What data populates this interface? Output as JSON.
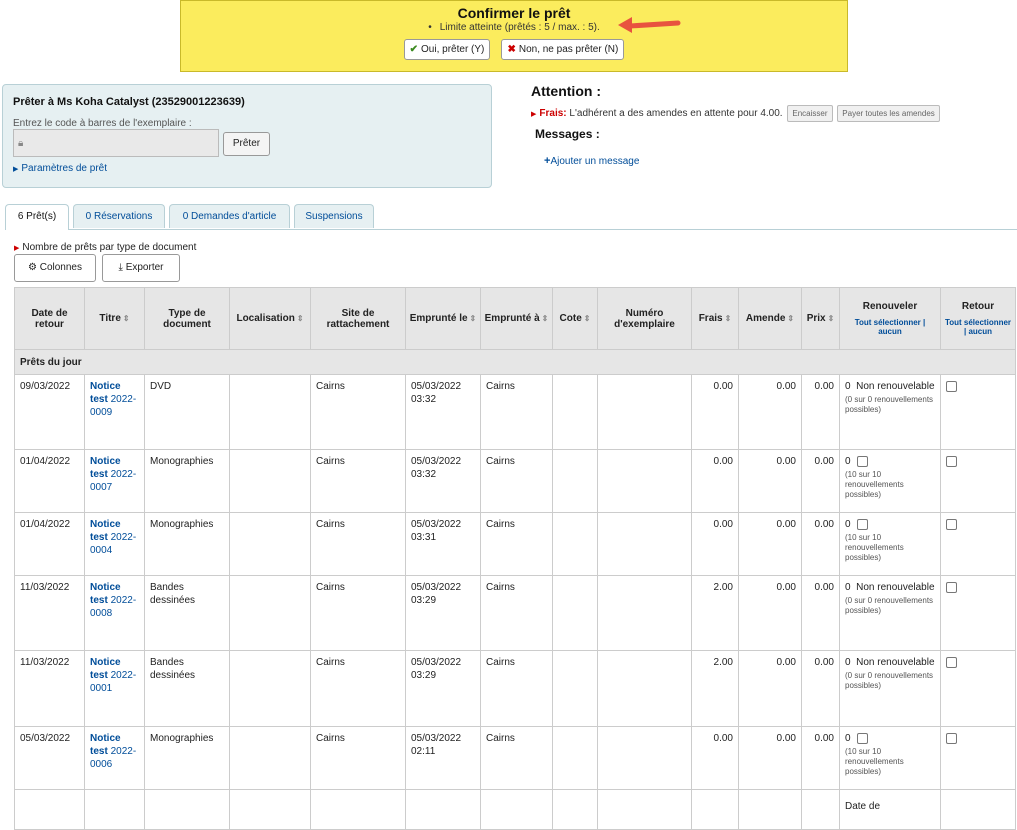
{
  "confirm": {
    "title": "Confirmer le prêt",
    "limit_text": "Limite atteinte (prêtés : 5 / max. : 5).",
    "yes_label": "Oui, prêter (Y)",
    "no_label": "Non, ne pas prêter (N)"
  },
  "checkout": {
    "title": "Prêter à Ms Koha Catalyst (23529001223639)",
    "barcode_label": "Entrez le code à barres de l'exemplaire :",
    "button": "Prêter",
    "settings_link": "Paramètres de prêt"
  },
  "attention": {
    "title": "Attention :",
    "fines_label": "Frais:",
    "fines_text": "L'adhérent a des amendes en attente pour 4.00.",
    "pay_button": "Encaisser",
    "pay_all_button": "Payer toutes les amendes",
    "messages_title": "Messages :",
    "add_message": "Ajouter un message"
  },
  "tabs": [
    "6 Prêt(s)",
    "0 Réservations",
    "0 Demandes d'article",
    "Suspensions"
  ],
  "count_by_type": "Nombre de prêts par type de document",
  "toolbar": {
    "columns": "Colonnes",
    "export": "Exporter"
  },
  "table": {
    "headers": {
      "due": "Date de retour",
      "title": "Titre",
      "itype": "Type de document",
      "location": "Localisation",
      "home": "Site de rattachement",
      "issued_on": "Emprunté le",
      "issued_at": "Emprunté à",
      "callno": "Cote",
      "itemno": "Numéro d'exemplaire",
      "fees": "Frais",
      "fine": "Amende",
      "price": "Prix",
      "renew": "Renouveler",
      "return": "Retour",
      "select_all": "Tout sélectionner",
      "select_none": "aucun",
      "sep": "|"
    },
    "group_label": "Prêts du jour",
    "rows": [
      {
        "due": "09/03/2022",
        "title_a": "Notice",
        "title_b": "test",
        "title_c": "2022-0009",
        "itype": "DVD",
        "home": "Cairns",
        "date": "05/03/2022",
        "time": "03:32",
        "at": "Cairns",
        "fees": "0.00",
        "fine": "0.00",
        "price": "0.00",
        "renew_count": "0",
        "renew_status": "Non renouvelable",
        "renew_note": "(0 sur 0 renouvellements possibles)",
        "renewable": false
      },
      {
        "due": "01/04/2022",
        "title_a": "Notice",
        "title_b": "test",
        "title_c": "2022-0007",
        "itype": "Monographies",
        "home": "Cairns",
        "date": "05/03/2022",
        "time": "03:32",
        "at": "Cairns",
        "fees": "0.00",
        "fine": "0.00",
        "price": "0.00",
        "renew_count": "0",
        "renew_status": "",
        "renew_note": "(10 sur 10 renouvellements possibles)",
        "renewable": true
      },
      {
        "due": "01/04/2022",
        "title_a": "Notice",
        "title_b": "test",
        "title_c": "2022-0004",
        "itype": "Monographies",
        "home": "Cairns",
        "date": "05/03/2022",
        "time": "03:31",
        "at": "Cairns",
        "fees": "0.00",
        "fine": "0.00",
        "price": "0.00",
        "renew_count": "0",
        "renew_status": "",
        "renew_note": "(10 sur 10 renouvellements possibles)",
        "renewable": true
      },
      {
        "due": "11/03/2022",
        "title_a": "Notice",
        "title_b": "test",
        "title_c": "2022-0008",
        "itype": "Bandes dessinées",
        "home": "Cairns",
        "date": "05/03/2022",
        "time": "03:29",
        "at": "Cairns",
        "fees": "2.00",
        "fine": "0.00",
        "price": "0.00",
        "renew_count": "0",
        "renew_status": "Non renouvelable",
        "renew_note": "(0 sur 0 renouvellements possibles)",
        "renewable": false
      },
      {
        "due": "11/03/2022",
        "title_a": "Notice",
        "title_b": "test",
        "title_c": "2022-0001",
        "itype": "Bandes dessinées",
        "home": "Cairns",
        "date": "05/03/2022",
        "time": "03:29",
        "at": "Cairns",
        "fees": "2.00",
        "fine": "0.00",
        "price": "0.00",
        "renew_count": "0",
        "renew_status": "Non renouvelable",
        "renew_note": "(0 sur 0 renouvellements possibles)",
        "renewable": false
      },
      {
        "due": "05/03/2022",
        "title_a": "Notice",
        "title_b": "test",
        "title_c": "2022-0006",
        "itype": "Monographies",
        "home": "Cairns",
        "date": "05/03/2022",
        "time": "02:11",
        "at": "Cairns",
        "fees": "0.00",
        "fine": "0.00",
        "price": "0.00",
        "renew_count": "0",
        "renew_status": "",
        "renew_note": "(10 sur 10 renouvellements possibles)",
        "renewable": true
      }
    ],
    "footer_partial": "Date de"
  }
}
